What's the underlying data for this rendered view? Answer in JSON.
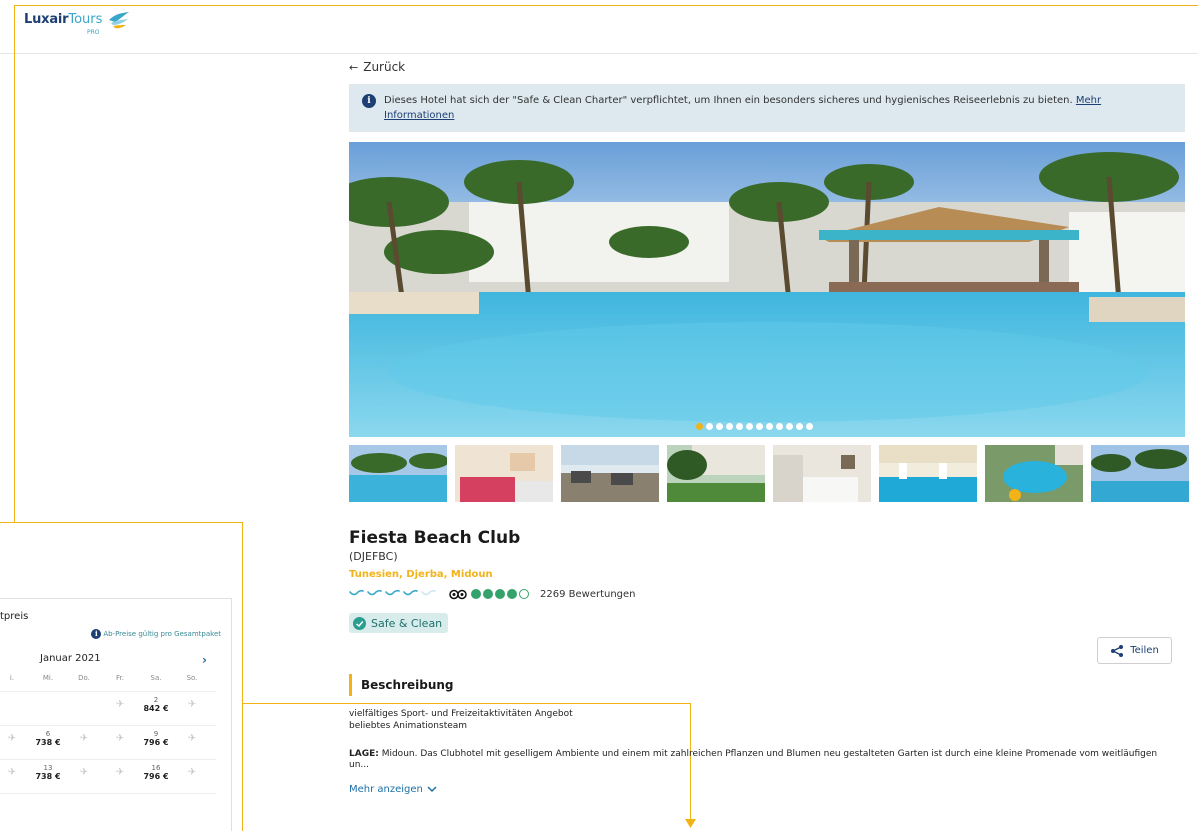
{
  "brand": {
    "logo_part1": "Luxair",
    "logo_part2": "Tours",
    "logo_sub": "PRO",
    "accent": "#f2b318",
    "navy": "#1d3f73"
  },
  "nav": {
    "back_label": "Zurück"
  },
  "notice": {
    "text": "Dieses Hotel hat sich der \"Safe & Clean Charter\" verpflichtet, um Ihnen ein besonders sicheres und hygienisches Reiseerlebnis zu bieten. ",
    "link": "Mehr Informationen"
  },
  "gallery": {
    "slide_count": 12,
    "active_slide": 1,
    "thumb_icons": [
      "pool-photo",
      "room-photo",
      "restaurant-photo",
      "garden-photo",
      "bedroom-photo",
      "indoor-pool-photo",
      "aerial-pool-photo",
      "beach-palm-photo"
    ]
  },
  "hotel": {
    "name": "Fiesta Beach Club",
    "code": "(DJEFBC)",
    "location": "Tunesien, Djerba, Midoun",
    "stars": 4,
    "stars_max": 5,
    "tripadvisor_rating": 4,
    "tripadvisor_max": 5,
    "review_count": "2269 Bewertungen",
    "badge": "Safe & Clean"
  },
  "share": {
    "label": "Teilen"
  },
  "description": {
    "heading": "Beschreibung",
    "line1": "vielfältiges Sport- und Freizeitaktivitäten Angebot",
    "line2": "beliebtes Animationsteam",
    "lage_label": "LAGE:",
    "lage_text": " Midoun. Das Clubhotel mit geselligem Ambiente und einem mit zahlreichen Pflanzen und Blumen neu gestalteten Garten ist durch eine kleine Promenade vom weitläufigen un...",
    "more_label": "Mehr anzeigen"
  },
  "calendar": {
    "title": "tpreis",
    "note": "Ab-Preise gültig pro Gesamtpaket",
    "month": "Januar 2021",
    "next_icon": "chevron-right-icon",
    "days": [
      "i.",
      "Mi.",
      "Do.",
      "Fr.",
      "Sa.",
      "So."
    ],
    "rows": [
      [
        {
          "type": "empty"
        },
        {
          "type": "empty"
        },
        {
          "type": "empty"
        },
        {
          "type": "plane"
        },
        {
          "type": "price",
          "day": "2",
          "price": "842 €"
        },
        {
          "type": "plane"
        }
      ],
      [
        {
          "type": "plane"
        },
        {
          "type": "price",
          "day": "6",
          "price": "738 €"
        },
        {
          "type": "plane"
        },
        {
          "type": "plane"
        },
        {
          "type": "price",
          "day": "9",
          "price": "796 €"
        },
        {
          "type": "plane"
        }
      ],
      [
        {
          "type": "plane"
        },
        {
          "type": "price",
          "day": "13",
          "price": "738 €"
        },
        {
          "type": "plane"
        },
        {
          "type": "plane"
        },
        {
          "type": "price",
          "day": "16",
          "price": "796 €"
        },
        {
          "type": "plane"
        }
      ]
    ]
  }
}
